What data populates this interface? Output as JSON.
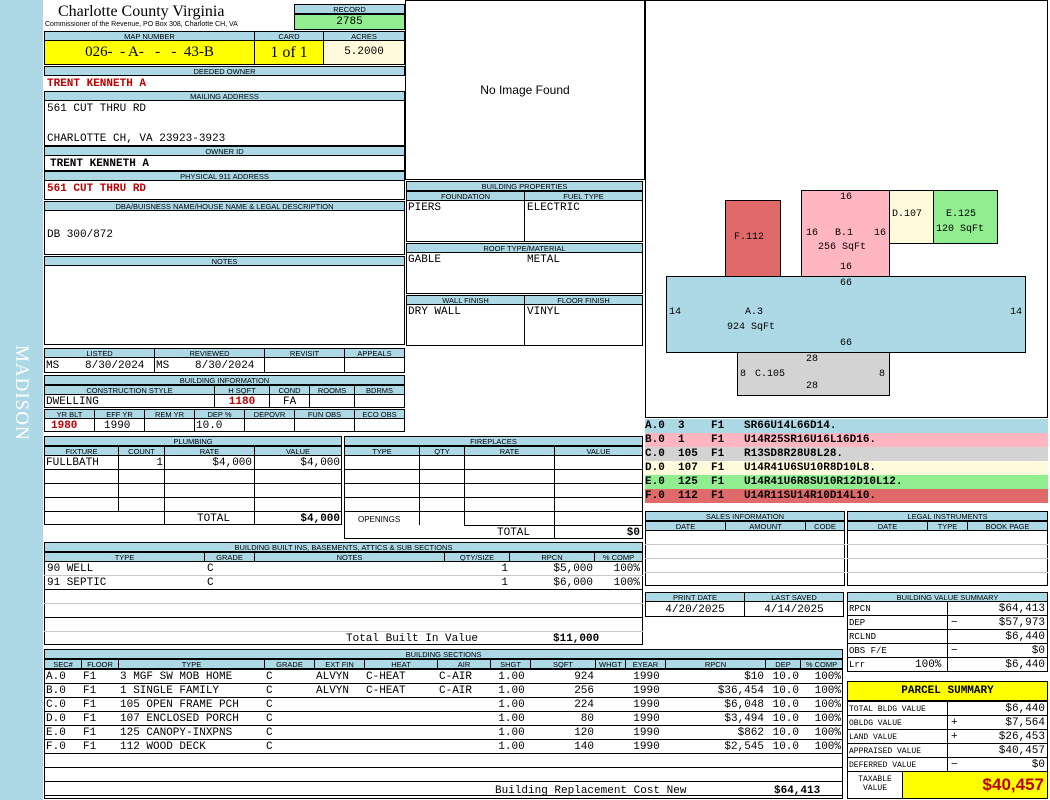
{
  "sidebar": {
    "district": "MADISON"
  },
  "header": {
    "county": "Charlotte County Virginia",
    "commissioner": "Commissioner of the Revenue, PO Box 308, Charlotte CH, VA",
    "record_label": "RECORD",
    "record": "2785",
    "map_label": "MAP NUMBER",
    "map_number": "026-  - A-   -   -  43-B",
    "card_label": "CARD",
    "card": "1 of 1",
    "acres_label": "ACRES",
    "acres": "5.2000"
  },
  "owner": {
    "deeded_label": "DEEDED OWNER",
    "deeded_owner": "TRENT KENNETH A",
    "mailing_label": "MAILING ADDRESS",
    "mailing_line1": "561 CUT THRU RD",
    "mailing_line2": "CHARLOTTE CH, VA 23923-3923",
    "owner_id_label": "OWNER ID",
    "owner_id": "TRENT KENNETH A",
    "physical_label": "PHYSICAL 911 ADDRESS",
    "physical_address": "561 CUT THRU RD",
    "dba_label": "DBA/BUISNESS NAME/HOUSE NAME & LEGAL DESCRIPTION",
    "dba": "DB 300/872",
    "notes_label": "NOTES"
  },
  "image": {
    "no_image": "No Image Found"
  },
  "building_properties": {
    "title": "BUILDING PROPERTIES",
    "foundation_label": "FOUNDATION",
    "foundation": "PIERS",
    "fuel_label": "FUEL TYPE",
    "fuel": "ELECTRIC",
    "roof_label": "ROOF TYPE/MATERIAL",
    "roof_type": "GABLE",
    "roof_material": "METAL",
    "wall_label": "WALL FINISH",
    "wall": "DRY WALL",
    "floor_label": "FLOOR FINISH",
    "floor": "VINYL"
  },
  "listing": {
    "listed_label": "LISTED",
    "listed_by": "MS",
    "listed_date": "8/30/2024",
    "reviewed_label": "REVIEWED",
    "reviewed_by": "MS",
    "reviewed_date": "8/30/2024",
    "revisit_label": "REVISIT",
    "appeals_label": "APPEALS"
  },
  "building_info": {
    "title": "BUILDING INFORMATION",
    "style_label": "CONSTRUCTION STYLE",
    "style": "DWELLING",
    "hsqft_label": "H SQFT",
    "hsqft": "1180",
    "cond_label": "COND",
    "cond": "FA",
    "rooms_label": "ROOMS",
    "bdrms_label": "BDRMS",
    "yrblt_label": "YR BLT",
    "yrblt": "1980",
    "effyr_label": "EFF YR",
    "effyr": "1990",
    "remyr_label": "REM YR",
    "dep_label": "DEP %",
    "dep": "10.0",
    "depovr_label": "DEPOVR",
    "funobs_label": "FUN OBS",
    "ecoobs_label": "ECO OBS"
  },
  "plumbing": {
    "title": "PLUMBING",
    "cols": [
      "FIXTURE",
      "COUNT",
      "RATE",
      "VALUE"
    ],
    "rows": [
      {
        "fixture": "FULLBATH",
        "count": "1",
        "rate": "$4,000",
        "value": "$4,000"
      }
    ],
    "total_label": "TOTAL",
    "total": "$4,000"
  },
  "fireplaces": {
    "title": "FIREPLACES",
    "cols": [
      "TYPE",
      "QTY",
      "RATE",
      "VALUE"
    ],
    "openings_label": "OPENINGS",
    "total_label": "TOTAL",
    "total": "$0"
  },
  "builtins": {
    "title": "BUILDING BUILT INS, BASEMENTS, ATTICS & SUB SECTIONS",
    "cols": [
      "TYPE",
      "GRADE",
      "NOTES",
      "QTY/SIZE",
      "RPCN",
      "% COMP"
    ],
    "rows": [
      {
        "type": "90 WELL",
        "grade": "C",
        "notes": "",
        "qty": "1",
        "rpcn": "$5,000",
        "comp": "100%"
      },
      {
        "type": "91 SEPTIC",
        "grade": "C",
        "notes": "",
        "qty": "1",
        "rpcn": "$6,000",
        "comp": "100%"
      }
    ],
    "total_label": "Total Built In Value",
    "total": "$11,000"
  },
  "sections": {
    "title": "BUILDING SECTIONS",
    "cols": [
      "SEC#",
      "FLOOR",
      "TYPE",
      "GRADE",
      "EXT FIN",
      "HEAT",
      "AIR",
      "SHGT",
      "SQFT",
      "WHGT",
      "EYEAR",
      "RPCN",
      "DEP",
      "% COMP"
    ],
    "rows": [
      {
        "sec": "A.0",
        "floor": "F1",
        "type": "3 MGF SW MOB HOME",
        "grade": "C",
        "ext": "ALVYN",
        "heat": "C-HEAT",
        "air": "C-AIR",
        "shgt": "1.00",
        "sqft": "924",
        "whgt": "",
        "eyear": "1990",
        "rpcn": "$10",
        "dep": "10.0",
        "comp": "100%"
      },
      {
        "sec": "B.0",
        "floor": "F1",
        "type": "1 SINGLE FAMILY",
        "grade": "C",
        "ext": "ALVYN",
        "heat": "C-HEAT",
        "air": "C-AIR",
        "shgt": "1.00",
        "sqft": "256",
        "whgt": "",
        "eyear": "1990",
        "rpcn": "$36,454",
        "dep": "10.0",
        "comp": "100%"
      },
      {
        "sec": "C.0",
        "floor": "F1",
        "type": "105 OPEN FRAME PCH",
        "grade": "C",
        "ext": "",
        "heat": "",
        "air": "",
        "shgt": "1.00",
        "sqft": "224",
        "whgt": "",
        "eyear": "1990",
        "rpcn": "$6,048",
        "dep": "10.0",
        "comp": "100%"
      },
      {
        "sec": "D.0",
        "floor": "F1",
        "type": "107 ENCLOSED PORCH",
        "grade": "C",
        "ext": "",
        "heat": "",
        "air": "",
        "shgt": "1.00",
        "sqft": "80",
        "whgt": "",
        "eyear": "1990",
        "rpcn": "$3,494",
        "dep": "10.0",
        "comp": "100%"
      },
      {
        "sec": "E.0",
        "floor": "F1",
        "type": "125 CANOPY-INXPNS",
        "grade": "C",
        "ext": "",
        "heat": "",
        "air": "",
        "shgt": "1.00",
        "sqft": "120",
        "whgt": "",
        "eyear": "1990",
        "rpcn": "$862",
        "dep": "10.0",
        "comp": "100%"
      },
      {
        "sec": "F.0",
        "floor": "F1",
        "type": "112 WOOD DECK",
        "grade": "C",
        "ext": "",
        "heat": "",
        "air": "",
        "shgt": "1.00",
        "sqft": "140",
        "whgt": "",
        "eyear": "1990",
        "rpcn": "$2,545",
        "dep": "10.0",
        "comp": "100%"
      }
    ],
    "total_label": "Building Replacement Cost New",
    "total": "$64,413"
  },
  "sketch": {
    "shapes": [
      {
        "id": "F.112",
        "label": "F.112"
      },
      {
        "id": "B.1",
        "label": "B.1",
        "sqft": "256 SqFt",
        "dims": [
          "16",
          "16",
          "16",
          "16"
        ]
      },
      {
        "id": "D.107",
        "label": "D.107"
      },
      {
        "id": "E.125",
        "label": "E.125",
        "sqft": "120 SqFt"
      },
      {
        "id": "A.3",
        "label": "A.3",
        "sqft": "924 SqFt",
        "dims": [
          "66",
          "14",
          "66",
          "14"
        ]
      },
      {
        "id": "C.105",
        "label": "C.105",
        "dims": [
          "28",
          "8",
          "28",
          "8"
        ]
      }
    ]
  },
  "sketch_legend": [
    {
      "text": "A.0  3    F1   SR66U14L66D14.",
      "color": "#add8e6"
    },
    {
      "text": "B.0  1    F1   U14R25SR16U16L16D16.",
      "color": "#ffb6c1"
    },
    {
      "text": "C.0  105  F1   R13SD8R28U8L28.",
      "color": "#d3d3d3"
    },
    {
      "text": "D.0  107  F1   U14R41U6SU10R8D10L8.",
      "color": "#fffadc"
    },
    {
      "text": "E.0  125  F1   U14R41U6R8SU10R12D10L12.",
      "color": "#90ee90"
    },
    {
      "text": "F.0  112  F1   U14R11SU14R10D14L10.",
      "color": "#e06a6a"
    }
  ],
  "sales": {
    "title": "SALES INFORMATION",
    "cols": [
      "DATE",
      "AMOUNT",
      "CODE"
    ]
  },
  "legal": {
    "title": "LEGAL INSTRUMENTS",
    "cols": [
      "DATE",
      "TYPE",
      "BOOK PAGE"
    ]
  },
  "dates": {
    "print_label": "PRINT DATE",
    "print_date": "4/20/2025",
    "saved_label": "LAST SAVED",
    "saved_date": "4/14/2025"
  },
  "value_summary": {
    "title": "BUILDING VALUE SUMMARY",
    "rows": [
      {
        "label": "RPCN",
        "sign": "",
        "value": "$64,413"
      },
      {
        "label": "DEP",
        "sign": "−",
        "value": "$57,973"
      },
      {
        "label": "RCLND",
        "sign": "",
        "value": "$6,440"
      },
      {
        "label": "OBS F/E",
        "sign": "−",
        "value": "$0"
      },
      {
        "label": "Lrr",
        "pct": "100%",
        "sign": "",
        "value": "$6,440"
      }
    ]
  },
  "parcel": {
    "title": "PARCEL SUMMARY",
    "rows": [
      {
        "label": "TOTAL BLDG VALUE",
        "sign": "",
        "value": "$6,440"
      },
      {
        "label": "OBLDG VALUE",
        "sign": "+",
        "value": "$7,564"
      },
      {
        "label": "LAND VALUE",
        "sign": "+",
        "value": "$26,453"
      },
      {
        "label": "APPRAISED VALUE",
        "sign": "",
        "value": "$40,457"
      },
      {
        "label": "DEFERRED VALUE",
        "sign": "−",
        "value": "$0"
      }
    ],
    "taxable_label_1": "TAXABLE",
    "taxable_label_2": "VALUE",
    "taxable": "$40,457"
  },
  "colors": {
    "header": "#add8e6",
    "yellow": "#ffff00",
    "record_green": "#90ee90",
    "red_text": "#c00000"
  }
}
